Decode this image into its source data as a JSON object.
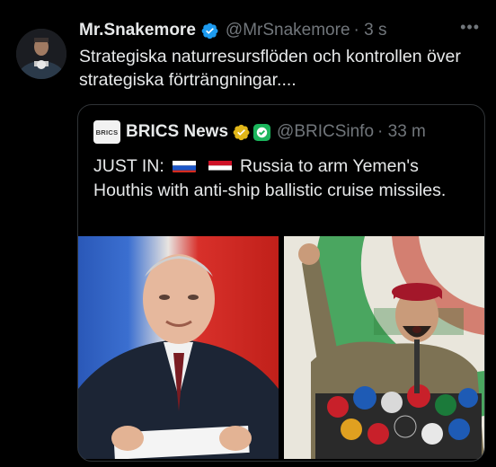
{
  "tweet": {
    "display_name": "Mr.Snakemore",
    "handle": "@MrSnakemore",
    "time": "· 3 s",
    "text": "Strategiska naturresursflöden och kontrollen över strategiska förträngningar....",
    "more_icon": "more-dots-icon"
  },
  "quoted": {
    "logo_text": "BRICS",
    "display_name": "BRICS News",
    "handle": "@BRICSinfo",
    "time": "· 33 m",
    "text_prefix": "JUST IN:",
    "text_main": "Russia to arm Yemen's Houthis with anti-ship ballistic cruise missiles.",
    "flags": [
      "russia-flag",
      "yemen-flag"
    ]
  },
  "colors": {
    "background": "#000000",
    "text": "#e7e9ea",
    "secondary": "#71767b",
    "verified_blue": "#1d9bf0",
    "verified_gold": "#e2b719",
    "border": "#2f3336"
  }
}
